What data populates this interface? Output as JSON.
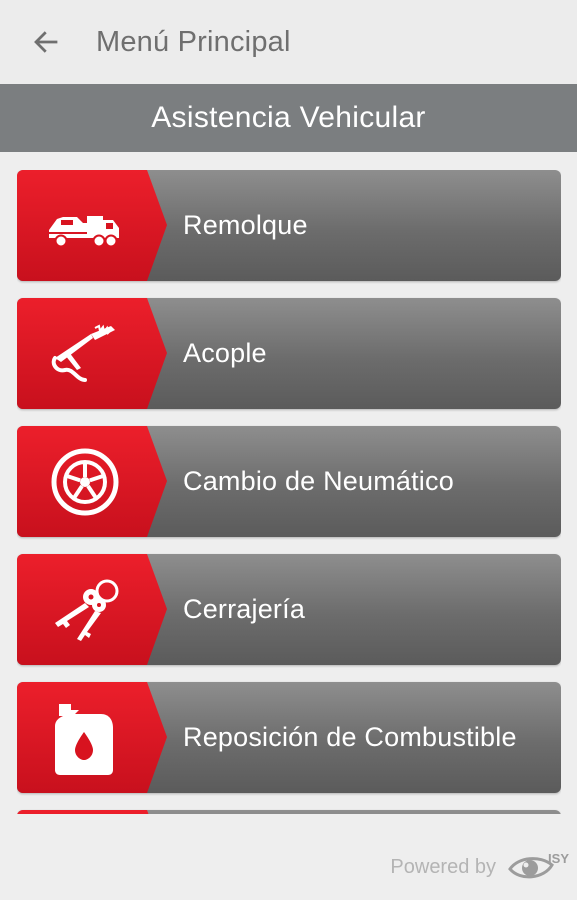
{
  "appbar": {
    "title": "Menú Principal",
    "back_icon": "arrow-left-icon"
  },
  "section": {
    "title": "Asistencia Vehicular"
  },
  "menu": {
    "items": [
      {
        "label": "Remolque",
        "icon": "tow-truck-icon"
      },
      {
        "label": "Acople",
        "icon": "jumper-clamp-icon"
      },
      {
        "label": "Cambio de Neumático",
        "icon": "tire-icon"
      },
      {
        "label": "Cerrajería",
        "icon": "keys-icon"
      },
      {
        "label": "Reposición de Combustible",
        "icon": "fuel-can-icon"
      }
    ]
  },
  "footer": {
    "powered_label": "Powered by",
    "brand": "ISY"
  },
  "colors": {
    "accent": "#e01c28",
    "bar": "#7b7e80",
    "item": "#6c6c6c",
    "background": "#eeeeee"
  }
}
